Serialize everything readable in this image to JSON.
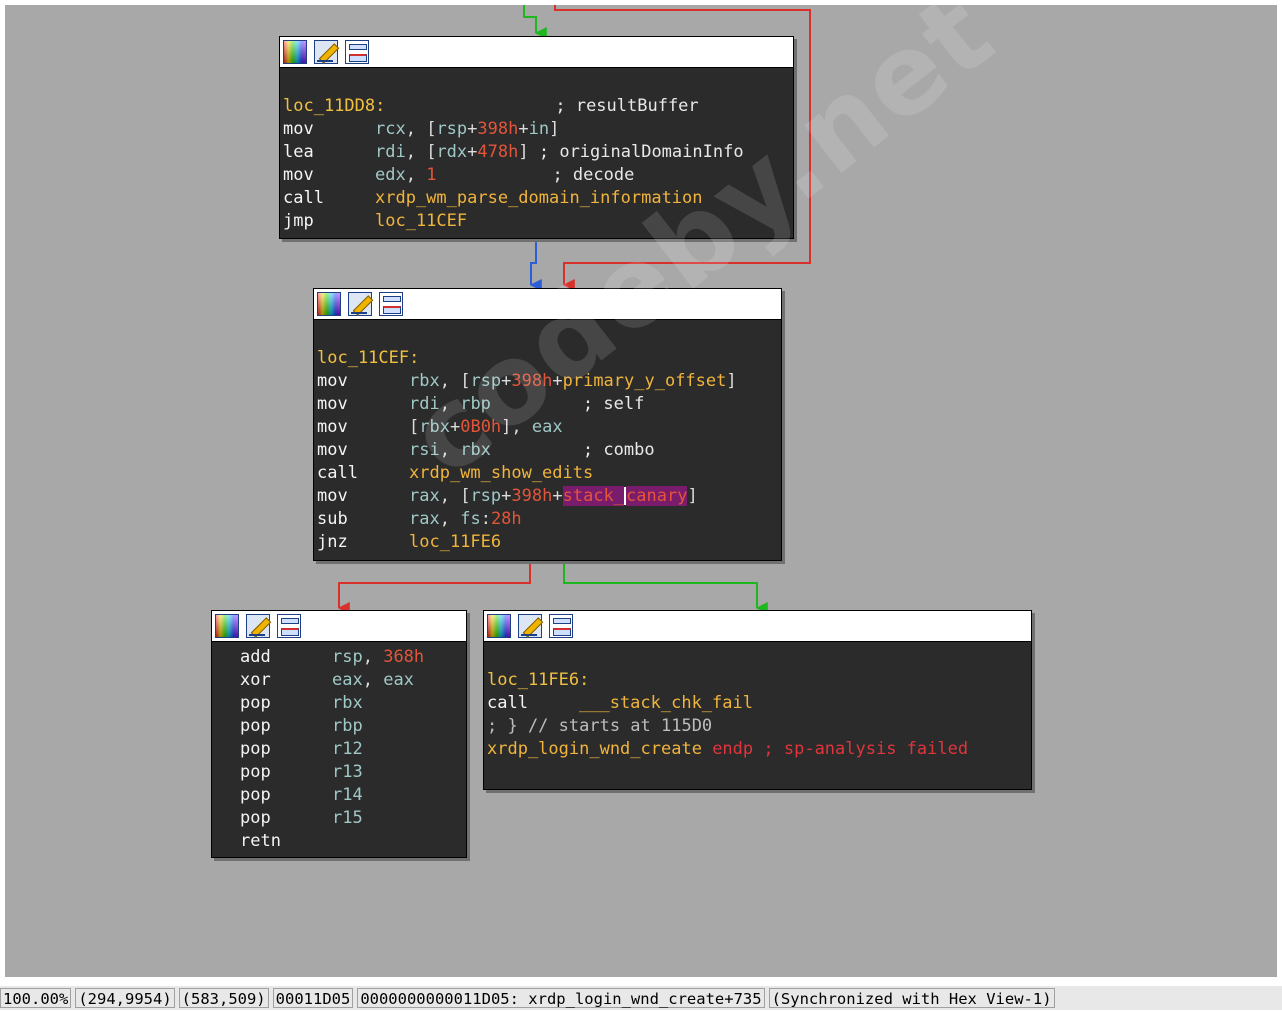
{
  "watermark": "codeby.net",
  "icons": [
    "color-palette-icon",
    "edit-node-icon",
    "graph-overview-icon"
  ],
  "colors": {
    "canvas": "#a8a8a8",
    "node_bg": "#2b2b2b",
    "edge_true": "#1db81d",
    "edge_false": "#d9302c",
    "edge_uncond": "#2a5fd8",
    "label": "#f0c040",
    "register": "#9fc8c6",
    "number": "#e2553a"
  },
  "nodes": {
    "n1": {
      "label": "loc_11DD8:",
      "label_comment": "; resultBuffer",
      "lines": [
        {
          "op": "mov",
          "a": "rcx",
          "b": ", [",
          "c": "rsp",
          "d": "+",
          "e": "398h",
          "f": "+",
          "g": "in",
          "h": "]",
          "comment": ""
        },
        {
          "op": "lea",
          "a": "rdi",
          "b": ", [",
          "c": "rdx",
          "d": "+",
          "e": "478h",
          "f": "",
          "g": "",
          "h": "]",
          "comment": "; originalDomainInfo"
        },
        {
          "op": "mov",
          "a": "edx",
          "b": ", ",
          "c": "",
          "d": "",
          "e": "1",
          "f": "",
          "g": "",
          "h": "",
          "comment": "; decode"
        },
        {
          "op": "call",
          "target": "xrdp_wm_parse_domain_information"
        },
        {
          "op": "jmp",
          "target": "loc_11CEF"
        }
      ]
    },
    "n2": {
      "label": "loc_11CEF:",
      "lines": [
        {
          "op": "mov",
          "a": "rbx",
          "b": ", [",
          "c": "rsp",
          "d": "+",
          "e": "398h",
          "f": "+",
          "g": "primary_y_offset",
          "h": "]",
          "comment": ""
        },
        {
          "op": "mov",
          "a": "rdi",
          "b": ", ",
          "c": "rbp",
          "comment": "; self"
        },
        {
          "op": "mov",
          "a": "[",
          "b": "rbx",
          "c": "+",
          "d": "0B0h",
          "e": "], ",
          "f": "eax"
        },
        {
          "op": "mov",
          "a": "rsi",
          "b": ", ",
          "c": "rbx",
          "comment": "; combo"
        },
        {
          "op": "call",
          "target": "xrdp_wm_show_edits"
        },
        {
          "op": "mov",
          "a": "rax",
          "b": ", [",
          "c": "rsp",
          "d": "+",
          "e": "398h",
          "f": "+",
          "g1": "stack_",
          "g2": "canary",
          "h": "]"
        },
        {
          "op": "sub",
          "a": "rax",
          "b": ", ",
          "c": "fs",
          "d": ":",
          "e": "28h"
        },
        {
          "op": "jnz",
          "target": "loc_11FE6"
        }
      ]
    },
    "n3": {
      "lines": [
        {
          "op": "add",
          "a": "rsp",
          "b": ", ",
          "c": "368h"
        },
        {
          "op": "xor",
          "a": "eax",
          "b": ", ",
          "c": "eax"
        },
        {
          "op": "pop",
          "a": "rbx"
        },
        {
          "op": "pop",
          "a": "rbp"
        },
        {
          "op": "pop",
          "a": "r12"
        },
        {
          "op": "pop",
          "a": "r13"
        },
        {
          "op": "pop",
          "a": "r14"
        },
        {
          "op": "pop",
          "a": "r15"
        },
        {
          "op": "retn"
        }
      ]
    },
    "n4": {
      "label": "loc_11FE6:",
      "call_op": "call",
      "call_target": "___stack_chk_fail",
      "comment": "; } // starts at 115D0",
      "endp_name": "xrdp_login_wnd_create",
      "endp_kw": "endp",
      "endp_comment": "; sp-analysis failed"
    }
  },
  "status": {
    "zoom": "100.00%",
    "coords1": "(294,9954)",
    "coords2": "(583,509)",
    "offset": "00011D05",
    "location": "0000000000011D05: xrdp_login_wnd_create+735",
    "sync": "(Synchronized with Hex View-1)"
  }
}
